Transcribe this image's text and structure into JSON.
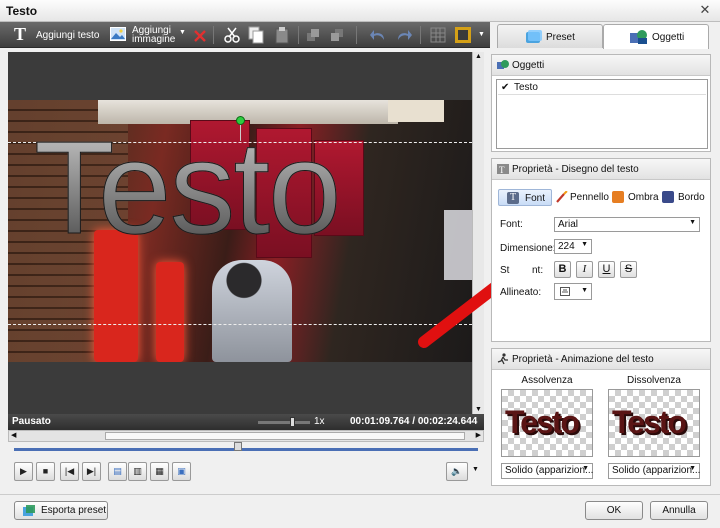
{
  "window": {
    "title": "Testo",
    "close_glyph": "✕"
  },
  "toolbar": {
    "add_text_label": "Aggiungi testo",
    "add_image_label_1": "Aggiungi",
    "add_image_label_2": "immagine"
  },
  "tabs": [
    {
      "label": "Preset",
      "active": false
    },
    {
      "label": "Oggetti",
      "active": true
    }
  ],
  "preview": {
    "text": "Testo",
    "status": "Pausato",
    "speed": "1x",
    "time": "00:01:09.764 / 00:02:24.644"
  },
  "objects_panel": {
    "title": "Oggetti",
    "items": [
      {
        "label": "Testo",
        "checked": true
      }
    ]
  },
  "text_props": {
    "title": "Proprietà - Disegno del testo",
    "subtabs": [
      "Font",
      "Pennello",
      "Ombra",
      "Bordo"
    ],
    "font_label": "Font:",
    "font_value": "Arial",
    "size_label": "Dimensione:",
    "size_value": "224",
    "style_label": "Stile testo:",
    "style_label_visible": "St",
    "style_label_visible_tail": "nt:",
    "style_buttons": [
      "B",
      "I",
      "U",
      "S"
    ],
    "align_label": "Allineato:",
    "align_label_visible": "Allineato:"
  },
  "anim_props": {
    "title": "Proprietà - Animazione del testo",
    "in_label": "Assolvenza",
    "out_label": "Dissolvenza",
    "thumb_text": "Testo",
    "in_value": "Solido (apparizion...",
    "out_value": "Solido (apparizion..."
  },
  "footer": {
    "export_label": "Esporta preset",
    "ok_label": "OK",
    "cancel_label": "Annulla"
  },
  "colors": {
    "arrow": "#e01010",
    "accent": "#4a6fb5",
    "handle": "#2ecc40"
  }
}
